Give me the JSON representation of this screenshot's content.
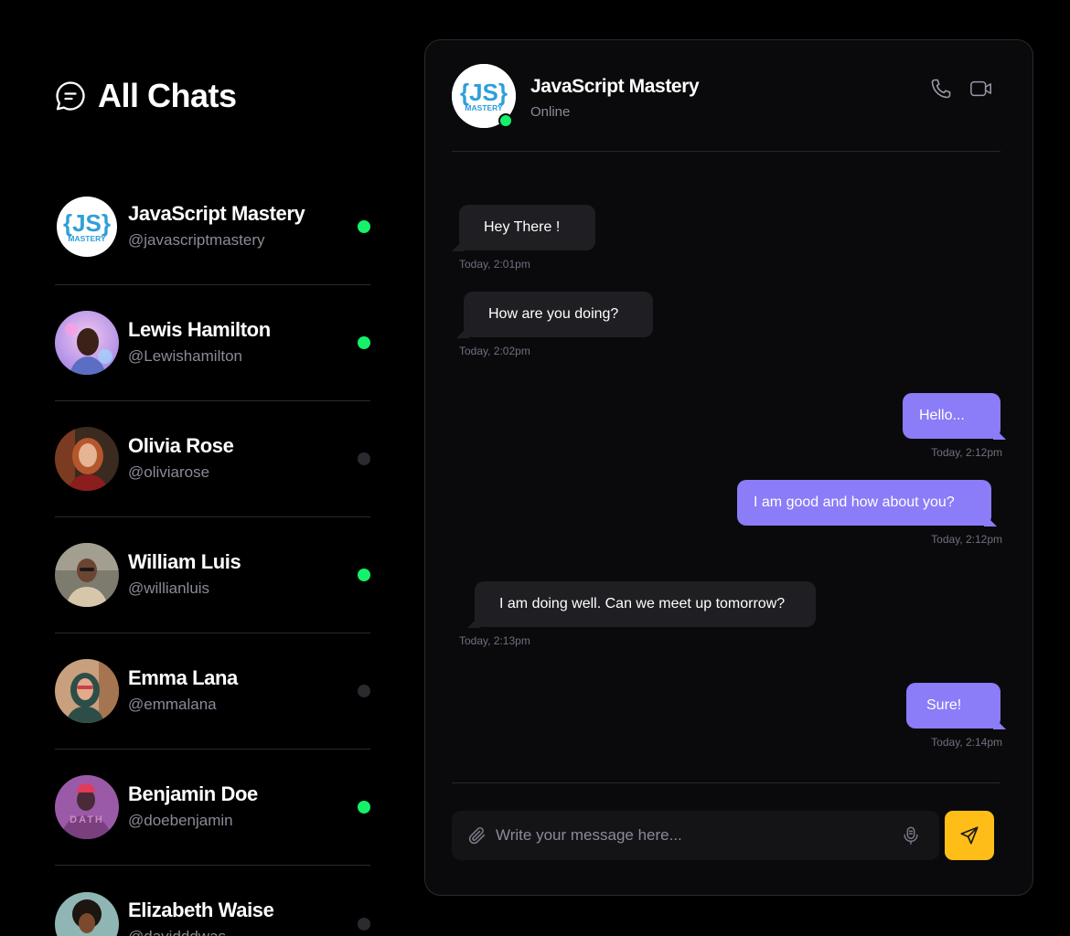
{
  "sidebar": {
    "title": "All Chats",
    "chats": [
      {
        "name": "JavaScript Mastery",
        "handle": "@javascriptmastery",
        "online": true
      },
      {
        "name": "Lewis Hamilton",
        "handle": "@Lewishamilton",
        "online": true
      },
      {
        "name": "Olivia Rose",
        "handle": "@oliviarose",
        "online": false
      },
      {
        "name": "William Luis",
        "handle": "@willianluis",
        "online": true
      },
      {
        "name": "Emma Lana",
        "handle": "@emmalana",
        "online": false
      },
      {
        "name": "Benjamin Doe",
        "handle": "@doebenjamin",
        "online": true
      },
      {
        "name": "Elizabeth Waise",
        "handle": "@davidddwas",
        "online": false
      }
    ]
  },
  "conversation": {
    "contact_name": "JavaScript Mastery",
    "contact_status": "Online",
    "logo_text": "{JS}",
    "logo_sub": "MASTERY",
    "messages": [
      {
        "direction": "in",
        "text": "Hey There !",
        "time": "Today, 2:01pm"
      },
      {
        "direction": "in",
        "text": "How are you doing?",
        "time": "Today, 2:02pm"
      },
      {
        "direction": "out",
        "text": "Hello...",
        "time": "Today, 2:12pm"
      },
      {
        "direction": "out",
        "text": "I am good and how about you?",
        "time": "Today, 2:12pm"
      },
      {
        "direction": "in",
        "text": "I am doing well. Can we meet up tomorrow?",
        "time": "Today, 2:13pm"
      },
      {
        "direction": "out",
        "text": "Sure!",
        "time": "Today, 2:14pm"
      }
    ]
  },
  "composer": {
    "placeholder": "Write your message here..."
  },
  "icons": {
    "chat": "chat-bubble-icon",
    "phone": "phone-icon",
    "video": "video-camera-icon",
    "attach": "paperclip-icon",
    "mic": "microphone-icon",
    "send": "send-icon"
  },
  "colors": {
    "background": "#000000",
    "panel": "#0a0a0c",
    "incoming_bubble": "#1f1f23",
    "outgoing_bubble": "#8b7cf8",
    "online": "#13f26a",
    "send_button": "#ffbe17"
  }
}
